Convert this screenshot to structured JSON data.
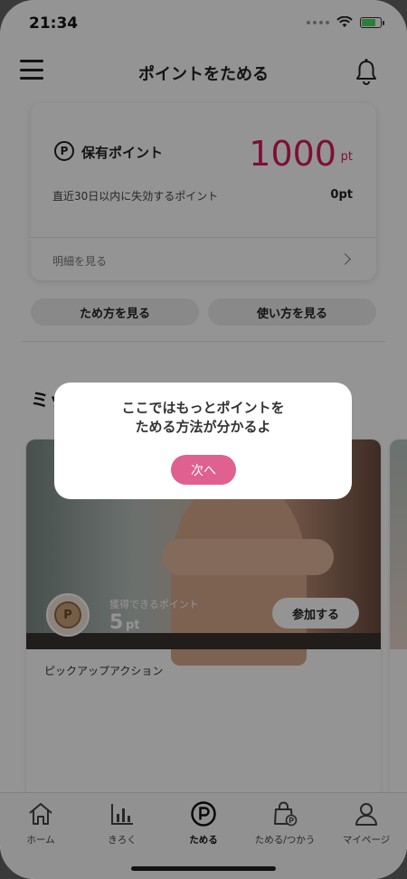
{
  "status_bar": {
    "time": "21:34"
  },
  "header": {
    "title": "ポイントをためる"
  },
  "points_card": {
    "p_symbol": "P",
    "label": "保有ポイント",
    "value": "1000",
    "unit": "pt",
    "expire_label": "直近30日以内に失効するポイント",
    "expire_value": "0pt",
    "detail_link": "明細を見る"
  },
  "buttons": {
    "how_to_earn": "ため方を見る",
    "how_to_use": "使い方を見る"
  },
  "mission": {
    "section_title": "ミッ",
    "coin_symbol": "P",
    "earn_label": "獲得できるポイント",
    "earn_value": "5",
    "earn_unit": "pt",
    "join_button": "参加する",
    "pickup_label": "ピックアップアクション"
  },
  "tabs": [
    {
      "label": "ホーム",
      "icon": "house-icon"
    },
    {
      "label": "きろく",
      "icon": "bar-chart-icon"
    },
    {
      "label": "ためる",
      "icon": "point-circle-icon",
      "active": true
    },
    {
      "label": "ためる/つかう",
      "icon": "shopping-bag-icon"
    },
    {
      "label": "マイページ",
      "icon": "person-icon"
    }
  ],
  "tooltip": {
    "line1": "ここではもっとポイントを",
    "line2": "ためる方法が分かるよ",
    "next_button": "次へ"
  },
  "colors": {
    "accent": "#d81b60",
    "next_button": "#e0608f"
  }
}
